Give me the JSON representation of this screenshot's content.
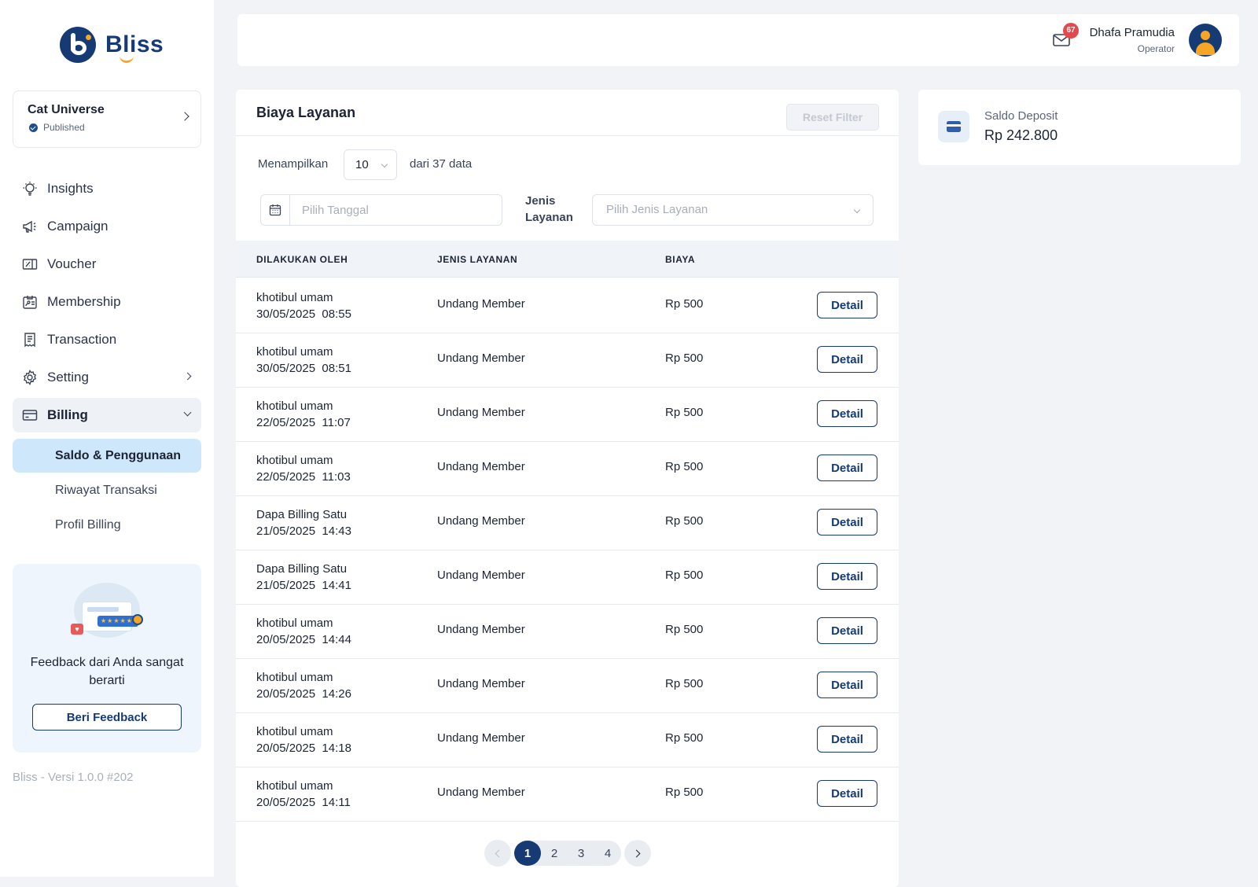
{
  "brand": {
    "logo_text": "Bliss"
  },
  "workspace": {
    "name": "Cat Universe",
    "status": "Published"
  },
  "nav": {
    "insights": "Insights",
    "campaign": "Campaign",
    "voucher": "Voucher",
    "membership": "Membership",
    "transaction": "Transaction",
    "setting": "Setting",
    "billing": "Billing",
    "billing_sub": [
      "Saldo & Penggunaan",
      "Riwayat Transaksi",
      "Profil Billing"
    ]
  },
  "feedback": {
    "text": "Feedback dari Anda sangat berarti",
    "button": "Beri Feedback"
  },
  "version": "Bliss - Versi 1.0.0 #202",
  "header": {
    "notifications": "67",
    "user_name": "Dhafa Pramudia",
    "user_role": "Operator"
  },
  "service_fees": {
    "title": "Biaya Layanan",
    "reset_label": "Reset Filter",
    "show_label": "Menampilkan",
    "page_size": "10",
    "total_label": "dari 37 data",
    "date_placeholder": "Pilih Tanggal",
    "type_label": "Jenis Layanan",
    "type_placeholder": "Pilih Jenis Layanan",
    "columns": [
      "DILAKUKAN OLEH",
      "JENIS LAYANAN",
      "BIAYA"
    ],
    "detail_label": "Detail",
    "rows": [
      {
        "name": "khotibul umam",
        "datetime": "30/05/2025  08:55",
        "type": "Undang Member",
        "cost": "Rp 500"
      },
      {
        "name": "khotibul umam",
        "datetime": "30/05/2025  08:51",
        "type": "Undang Member",
        "cost": "Rp 500"
      },
      {
        "name": "khotibul umam",
        "datetime": "22/05/2025  11:07",
        "type": "Undang Member",
        "cost": "Rp 500"
      },
      {
        "name": "khotibul umam",
        "datetime": "22/05/2025  11:03",
        "type": "Undang Member",
        "cost": "Rp 500"
      },
      {
        "name": "Dapa Billing Satu",
        "datetime": "21/05/2025  14:43",
        "type": "Undang Member",
        "cost": "Rp 500"
      },
      {
        "name": "Dapa Billing Satu",
        "datetime": "21/05/2025  14:41",
        "type": "Undang Member",
        "cost": "Rp 500"
      },
      {
        "name": "khotibul umam",
        "datetime": "20/05/2025  14:44",
        "type": "Undang Member",
        "cost": "Rp 500"
      },
      {
        "name": "khotibul umam",
        "datetime": "20/05/2025  14:26",
        "type": "Undang Member",
        "cost": "Rp 500"
      },
      {
        "name": "khotibul umam",
        "datetime": "20/05/2025  14:18",
        "type": "Undang Member",
        "cost": "Rp 500"
      },
      {
        "name": "khotibul umam",
        "datetime": "20/05/2025  14:11",
        "type": "Undang Member",
        "cost": "Rp 500"
      }
    ],
    "pagination": {
      "pages": [
        "1",
        "2",
        "3",
        "4"
      ],
      "current": "1"
    }
  },
  "deposit": {
    "label": "Saldo Deposit",
    "value": "Rp 242.800"
  },
  "colors": {
    "primary": "#163a73",
    "accent": "#f6a623",
    "active_sub": "#cfe7fa",
    "badge": "#e5484d"
  }
}
